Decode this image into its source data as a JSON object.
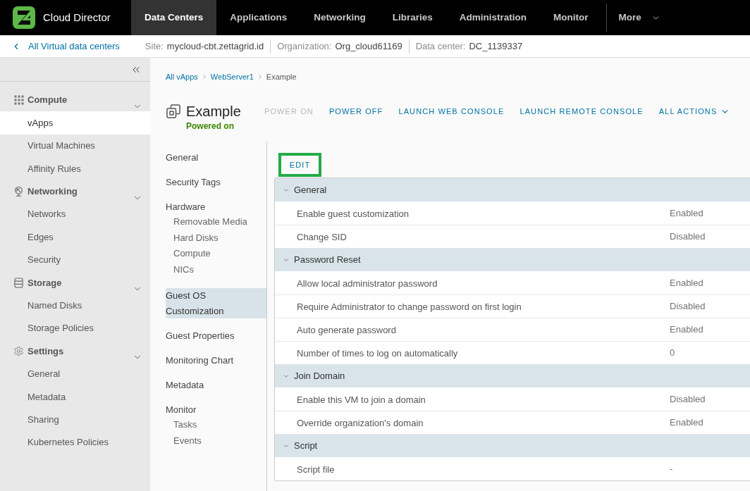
{
  "top_nav": {
    "product_name": "Cloud Director",
    "tabs": [
      {
        "label": "Data Centers",
        "selected": true
      },
      {
        "label": "Applications",
        "selected": false
      },
      {
        "label": "Networking",
        "selected": false
      },
      {
        "label": "Libraries",
        "selected": false
      },
      {
        "label": "Administration",
        "selected": false
      },
      {
        "label": "Monitor",
        "selected": false
      }
    ],
    "more_menu": "More"
  },
  "context_bar": {
    "back_link": "All Virtual data centers",
    "fields": [
      {
        "label": "Site:",
        "value": "mycloud-cbt.zettagrid.id"
      },
      {
        "label": "Organization:",
        "value": "Org_cloud61169"
      },
      {
        "label": "Data center:",
        "value": "DC_1139337"
      }
    ]
  },
  "sidebar": {
    "sections": [
      {
        "title": "Compute",
        "expanded": true,
        "items": [
          {
            "label": "vApps",
            "selected": true
          },
          {
            "label": "Virtual Machines",
            "selected": false
          },
          {
            "label": "Affinity Rules",
            "selected": false
          }
        ]
      },
      {
        "title": "Networking",
        "expanded": true,
        "items": [
          {
            "label": "Networks",
            "selected": false
          },
          {
            "label": "Edges",
            "selected": false
          },
          {
            "label": "Security",
            "selected": false
          }
        ]
      },
      {
        "title": "Storage",
        "expanded": true,
        "items": [
          {
            "label": "Named Disks",
            "selected": false
          },
          {
            "label": "Storage Policies",
            "selected": false
          }
        ]
      },
      {
        "title": "Settings",
        "expanded": true,
        "items": [
          {
            "label": "General",
            "selected": false
          },
          {
            "label": "Metadata",
            "selected": false
          },
          {
            "label": "Sharing",
            "selected": false
          },
          {
            "label": "Kubernetes Policies",
            "selected": false
          }
        ]
      }
    ]
  },
  "breadcrumb": [
    {
      "label": "All vApps",
      "kind": "link"
    },
    {
      "label": "WebServer1",
      "kind": "link"
    },
    {
      "label": "Example",
      "kind": "current"
    }
  ],
  "header": {
    "title": "Example",
    "status": "Powered on",
    "actions": [
      {
        "label": "POWER ON",
        "kind": "button",
        "disabled": true
      },
      {
        "label": "POWER OFF",
        "kind": "button",
        "disabled": false
      },
      {
        "label": "LAUNCH WEB CONSOLE",
        "kind": "button",
        "disabled": false
      },
      {
        "label": "LAUNCH REMOTE CONSOLE",
        "kind": "button",
        "disabled": false
      },
      {
        "label": "ALL ACTIONS",
        "kind": "dropdown",
        "disabled": false
      }
    ]
  },
  "subnav": {
    "items": [
      {
        "label": "General",
        "selected": false
      },
      {
        "label": "Security Tags",
        "selected": false
      },
      {
        "label": "Hardware",
        "selected": false,
        "children": [
          {
            "label": "Removable Media",
            "selected": false
          },
          {
            "label": "Hard Disks",
            "selected": false
          },
          {
            "label": "Compute",
            "selected": false
          },
          {
            "label": "NICs",
            "selected": false
          }
        ]
      },
      {
        "label": "Guest OS Customization",
        "selected": true
      },
      {
        "label": "Guest Properties",
        "selected": false
      },
      {
        "label": "Monitoring Chart",
        "selected": false
      },
      {
        "label": "Metadata",
        "selected": false
      },
      {
        "label": "Monitor",
        "selected": false,
        "children": [
          {
            "label": "Tasks",
            "selected": false
          },
          {
            "label": "Events",
            "selected": false
          }
        ]
      }
    ]
  },
  "edit_button": {
    "label": "EDIT",
    "highlighted": true
  },
  "details": {
    "sections": [
      {
        "title": "General",
        "expanded": true,
        "rows": [
          {
            "label": "Enable guest customization",
            "value": "Enabled"
          },
          {
            "label": "Change SID",
            "value": "Disabled"
          }
        ]
      },
      {
        "title": "Password Reset",
        "expanded": true,
        "rows": [
          {
            "label": "Allow local administrator password",
            "value": "Enabled"
          },
          {
            "label": "Require Administrator to change password on first login",
            "value": "Disabled"
          },
          {
            "label": "Auto generate password",
            "value": "Enabled"
          },
          {
            "label": "Number of times to log on automatically",
            "value": "0"
          }
        ]
      },
      {
        "title": "Join Domain",
        "expanded": true,
        "rows": [
          {
            "label": "Enable this VM to join a domain",
            "value": "Disabled"
          },
          {
            "label": "Override organization's domain",
            "value": "Enabled"
          }
        ]
      },
      {
        "title": "Script",
        "expanded": true,
        "rows": [
          {
            "label": "Script file",
            "value": "-"
          }
        ]
      }
    ]
  }
}
